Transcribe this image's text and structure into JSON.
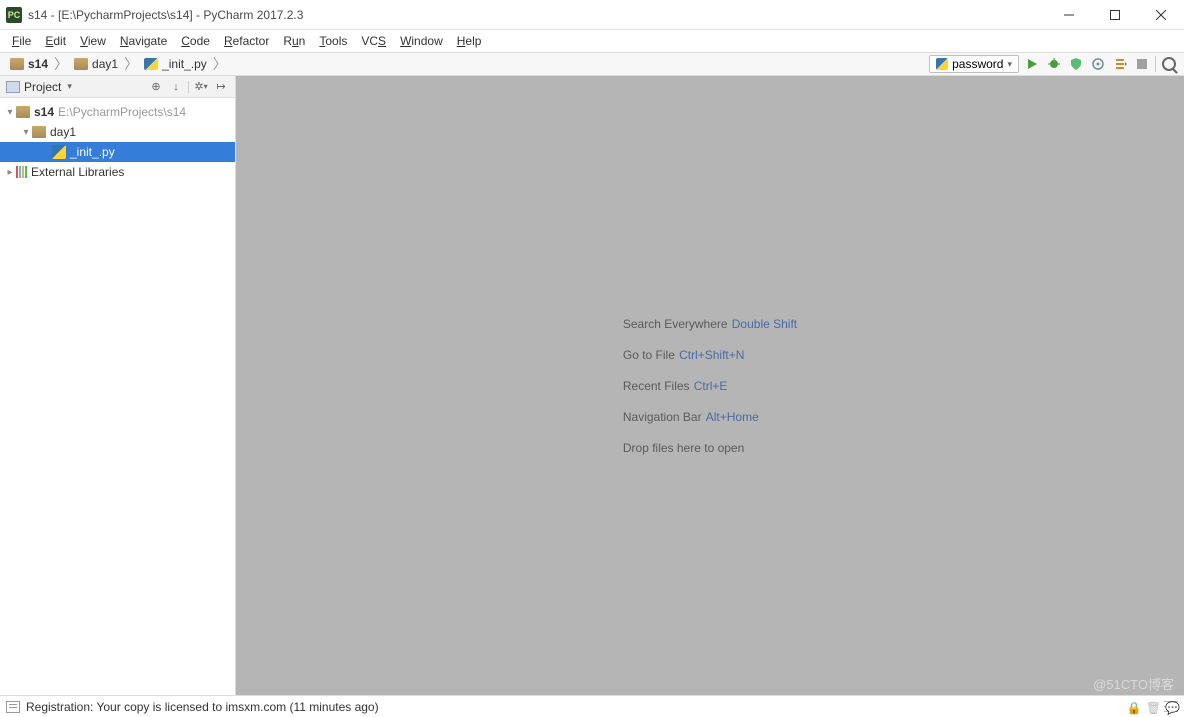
{
  "window": {
    "title": "s14 - [E:\\PycharmProjects\\s14] - PyCharm 2017.2.3"
  },
  "menu": [
    "File",
    "Edit",
    "View",
    "Navigate",
    "Code",
    "Refactor",
    "Run",
    "Tools",
    "VCS",
    "Window",
    "Help"
  ],
  "breadcrumbs": [
    {
      "label": "s14",
      "icon": "folder"
    },
    {
      "label": "day1",
      "icon": "folder"
    },
    {
      "label": "_init_.py",
      "icon": "python"
    }
  ],
  "toolbar": {
    "run_config": "password",
    "buttons": [
      "run",
      "debug",
      "coverage",
      "profile",
      "target",
      "stop",
      "search"
    ]
  },
  "project_tool": {
    "title": "Project",
    "root": {
      "name": "s14",
      "path": "E:\\PycharmProjects\\s14"
    },
    "day1": "day1",
    "file": "_init_.py",
    "external": "External Libraries"
  },
  "editor_tips": [
    {
      "text": "Search Everywhere",
      "shortcut": "Double Shift"
    },
    {
      "text": "Go to File",
      "shortcut": "Ctrl+Shift+N"
    },
    {
      "text": "Recent Files",
      "shortcut": "Ctrl+E"
    },
    {
      "text": "Navigation Bar",
      "shortcut": "Alt+Home"
    },
    {
      "text": "Drop files here to open",
      "shortcut": ""
    }
  ],
  "status": {
    "text": "Registration: Your copy is licensed to imsxm.com (11 minutes ago)"
  },
  "watermark": "@51CTO博客"
}
